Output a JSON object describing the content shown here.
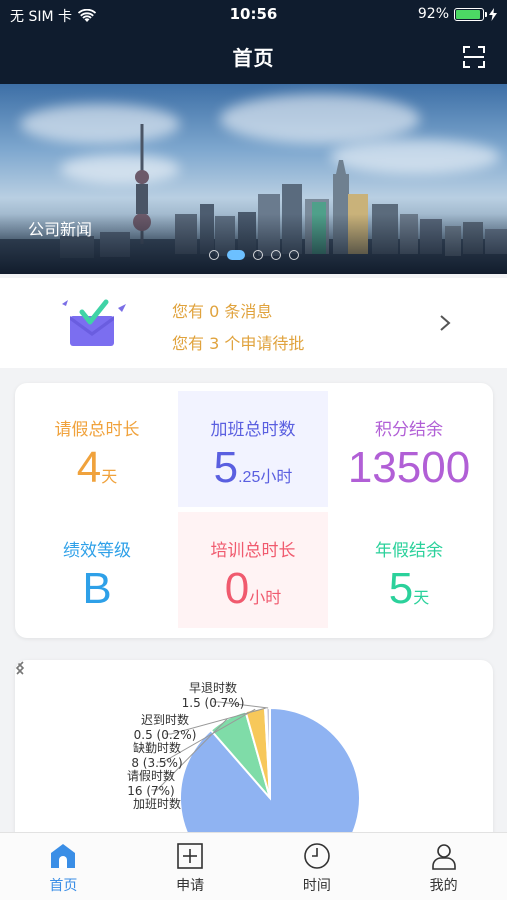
{
  "status_bar": {
    "carrier": "无 SIM 卡",
    "time": "10:56",
    "battery": "92%"
  },
  "nav": {
    "title": "首页",
    "scan_icon": "scan-icon"
  },
  "banner": {
    "caption": "公司新闻",
    "dot_count": 5,
    "active_dot": 1
  },
  "messages": {
    "line1": "您有 0 条消息",
    "line2": "您有 3 个申请待批"
  },
  "stats": [
    {
      "label": "请假总时长",
      "value": "4",
      "unit": "天",
      "color": "#f0a23c",
      "bg": "#ffffff"
    },
    {
      "label": "加班总时数",
      "value": "5",
      "unit": ".25小时",
      "color": "#5a5fe0",
      "bg": "#f2f3ff"
    },
    {
      "label": "积分结余",
      "value": "13500",
      "unit": "",
      "color": "#b15fd6",
      "bg": "#ffffff"
    },
    {
      "label": "绩效等级",
      "value": "B",
      "unit": "",
      "color": "#2ea0e8",
      "bg": "#ffffff"
    },
    {
      "label": "培训总时长",
      "value": "0",
      "unit": "小时",
      "color": "#f05a6e",
      "bg": "#fff3f4"
    },
    {
      "label": "年假结余",
      "value": "5",
      "unit": "天",
      "color": "#2bd19b",
      "bg": "#ffffff"
    }
  ],
  "chart_data": {
    "type": "pie",
    "slices": [
      {
        "name": "加班时数",
        "value": 202,
        "label": "",
        "color": "#8fb3f2"
      },
      {
        "name": "请假时数",
        "value": 16,
        "label": "16 (7%)",
        "color": "#7fdca8"
      },
      {
        "name": "缺勤时数",
        "value": 8,
        "label": "8 (3.5%)",
        "color": "#f7c85a"
      },
      {
        "name": "迟到时数",
        "value": 0.5,
        "label": "0.5 (0.2%)",
        "color": "#f08a78"
      },
      {
        "name": "早退时数",
        "value": 1.5,
        "label": "1.5 (0.7%)",
        "color": "#c8c8d8"
      }
    ]
  },
  "tabs": [
    {
      "label": "首页",
      "icon": "home-icon",
      "active": true
    },
    {
      "label": "申请",
      "icon": "plus-box-icon",
      "active": false
    },
    {
      "label": "时间",
      "icon": "clock-icon",
      "active": false
    },
    {
      "label": "我的",
      "icon": "user-icon",
      "active": false
    }
  ]
}
